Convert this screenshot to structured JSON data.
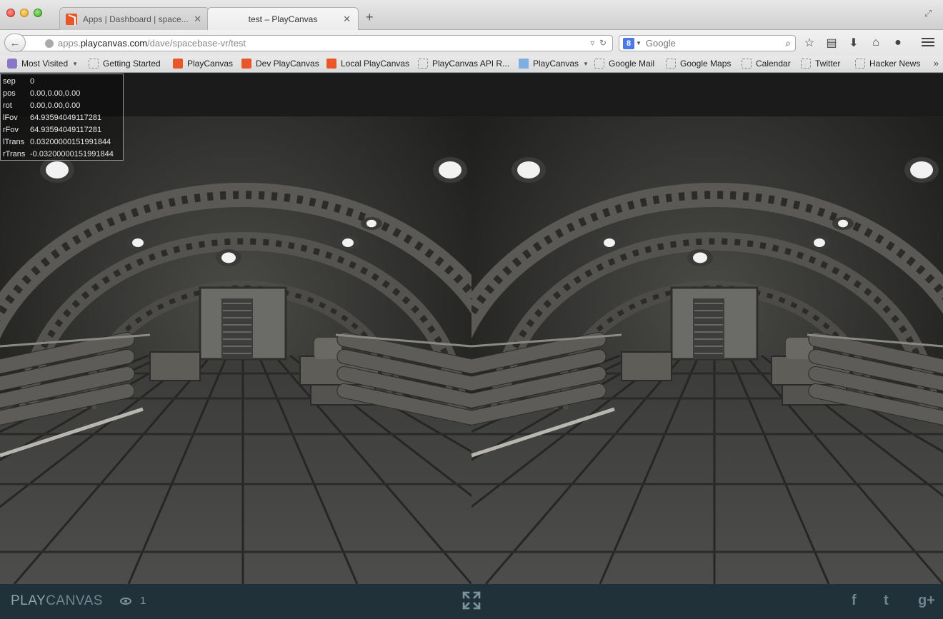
{
  "browser": {
    "tabs": [
      {
        "title": "Apps | Dashboard | space...",
        "active": false
      },
      {
        "title": "test – PlayCanvas",
        "active": true
      }
    ],
    "new_tab_label": "+",
    "url": {
      "prefix": "apps.",
      "host": "playcanvas.com",
      "path": "/dave/spacebase-vr/test"
    },
    "search": {
      "placeholder": "Google",
      "engine_letter": "8"
    },
    "bookmarks": [
      {
        "label": "Most Visited",
        "type": "folder-menu"
      },
      {
        "label": "Getting Started",
        "type": "page"
      },
      {
        "label": "PlayCanvas",
        "type": "playcanvas"
      },
      {
        "label": "Dev PlayCanvas",
        "type": "playcanvas"
      },
      {
        "label": "Local PlayCanvas",
        "type": "playcanvas"
      },
      {
        "label": "PlayCanvas API R...",
        "type": "page"
      },
      {
        "label": "PlayCanvas",
        "type": "folder"
      },
      {
        "label": "Google Mail",
        "type": "page"
      },
      {
        "label": "Google Maps",
        "type": "page"
      },
      {
        "label": "Calendar",
        "type": "page"
      },
      {
        "label": "Twitter",
        "type": "page"
      },
      {
        "label": "Hacker News",
        "type": "page"
      }
    ],
    "more_label": "»"
  },
  "debug": {
    "rows": [
      {
        "key": "sep",
        "value": "0"
      },
      {
        "key": "pos",
        "value": "0.00,0.00,0.00"
      },
      {
        "key": "rot",
        "value": "0.00,0.00,0.00"
      },
      {
        "key": "lFov",
        "value": "64.93594049117281"
      },
      {
        "key": "rFov",
        "value": "64.93594049117281"
      },
      {
        "key": "lTrans",
        "value": "0.03200000151991844"
      },
      {
        "key": "rTrans",
        "value": "-0.03200000151991844"
      }
    ]
  },
  "footer": {
    "brand_play": "PLAY",
    "brand_canvas": "CANVAS",
    "view_count": "1",
    "social": {
      "facebook": "f",
      "twitter": "t",
      "google_plus": "g+"
    }
  },
  "colors": {
    "footer_bg": "#213139",
    "footer_text": "#6f8590",
    "playcanvas_orange": "#e8562a"
  }
}
